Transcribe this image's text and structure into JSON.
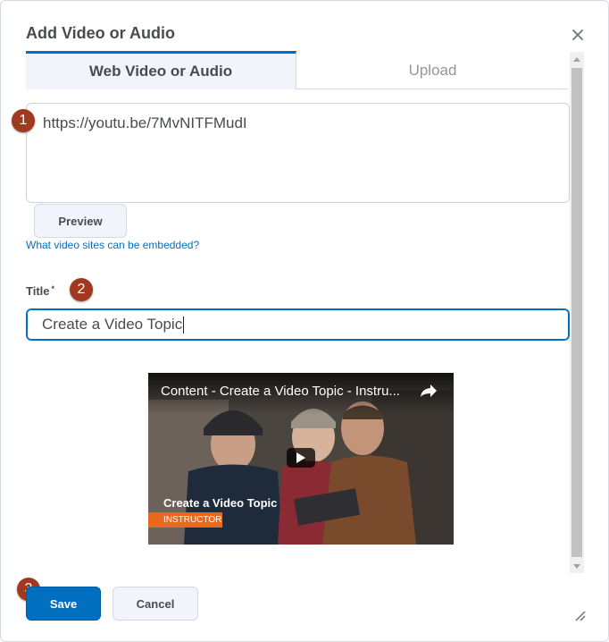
{
  "dialog": {
    "title": "Add Video or Audio",
    "close_icon": "close-icon"
  },
  "tabs": [
    {
      "label": "Web Video or Audio",
      "active": true
    },
    {
      "label": "Upload",
      "active": false
    }
  ],
  "url_field": {
    "value": "https://youtu.be/7MvNITFMudI"
  },
  "preview_button": {
    "label": "Preview"
  },
  "embed_help_link": {
    "label": "What video sites can be embedded?"
  },
  "title_field": {
    "label": "Title",
    "required_marker": "*",
    "value": "Create a Video Topic"
  },
  "video_preview": {
    "title": "Content - Create a Video Topic - Instru...",
    "caption": "Create a Video Topic",
    "tag": "INSTRUCTOR",
    "play_icon": "play-icon",
    "share_icon": "share-icon"
  },
  "step_badges": [
    "1",
    "2",
    "3"
  ],
  "footer": {
    "save_label": "Save",
    "cancel_label": "Cancel"
  },
  "colors": {
    "accent": "#006fbf",
    "badge": "#a0391f",
    "tag": "#e8681c"
  }
}
